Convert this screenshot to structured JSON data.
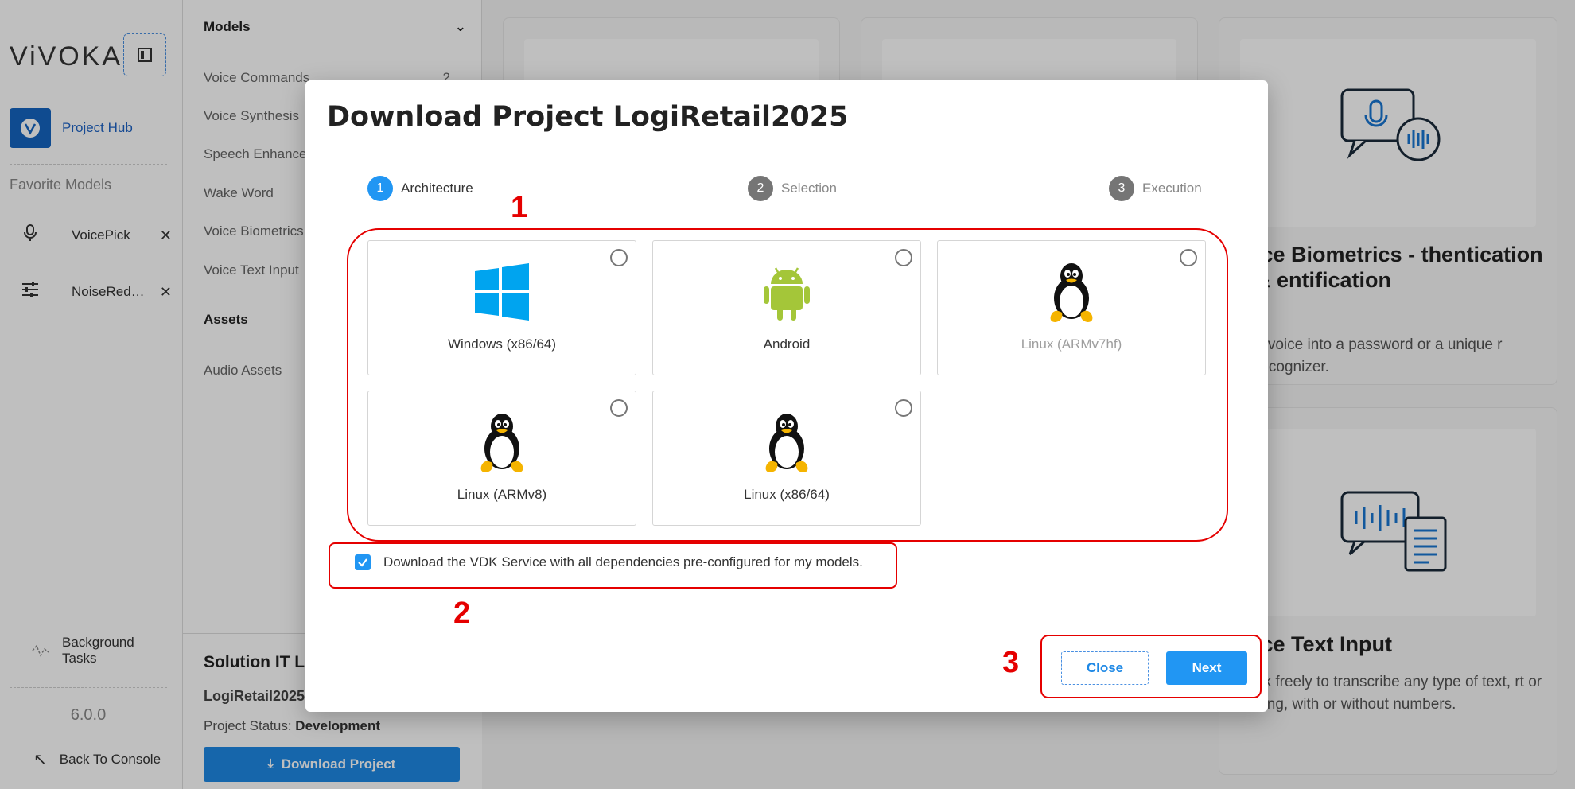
{
  "sidebar": {
    "logo": "ViVOKA",
    "hub_label": "Project Hub",
    "favorites_title": "Favorite Models",
    "favorites": [
      {
        "label": "VoicePick",
        "icon": "microphone-icon"
      },
      {
        "label": "NoiseReduc...",
        "icon": "sliders-icon"
      }
    ],
    "background_tasks": "Background Tasks",
    "version": "6.0.0",
    "back_to_console": "Back To Console"
  },
  "panel": {
    "models_header": "Models",
    "items": [
      {
        "label": "Voice Commands",
        "count": "2"
      },
      {
        "label": "Voice Synthesis"
      },
      {
        "label": "Speech Enhance"
      },
      {
        "label": "Wake Word"
      },
      {
        "label": "Voice Biometrics"
      },
      {
        "label": "Voice Text Input"
      }
    ],
    "assets_header": "Assets",
    "assets_items": [
      "Audio Assets"
    ],
    "solution_title": "Solution IT Lo",
    "project_name": "LogiRetail2025",
    "project_status_label": "Project Status:",
    "project_status_value": "Development",
    "download_button": "Download Project"
  },
  "cards": {
    "biometrics_title": "ice Biometrics - thentication & entification",
    "biometrics_desc": "n voice into a password or a unique r recognizer.",
    "textinput_title": "ice Text Input",
    "textinput_desc": "ak freely to transcribe any type of text, rt or long, with or without numbers."
  },
  "modal": {
    "title": "Download Project LogiRetail2025",
    "steps": [
      {
        "num": "1",
        "label": "Architecture",
        "active": true
      },
      {
        "num": "2",
        "label": "Selection",
        "active": false
      },
      {
        "num": "3",
        "label": "Execution",
        "active": false
      }
    ],
    "architectures": [
      {
        "label": "Windows (x86/64)",
        "icon": "windows-icon",
        "disabled": false
      },
      {
        "label": "Android",
        "icon": "android-icon",
        "disabled": false
      },
      {
        "label": "Linux (ARMv7hf)",
        "icon": "linux-icon",
        "disabled": true
      },
      {
        "label": "Linux (ARMv8)",
        "icon": "linux-icon",
        "disabled": false
      },
      {
        "label": "Linux (x86/64)",
        "icon": "linux-icon",
        "disabled": false
      }
    ],
    "checkbox_label": "Download the VDK Service with all dependencies pre-configured for my models.",
    "checkbox_checked": true,
    "close_button": "Close",
    "next_button": "Next"
  },
  "annotations": [
    "1",
    "2",
    "3"
  ],
  "colors": {
    "accent": "#2196f3",
    "annotation": "#e50000",
    "windows": "#00a4ef",
    "android": "#a4c639"
  }
}
